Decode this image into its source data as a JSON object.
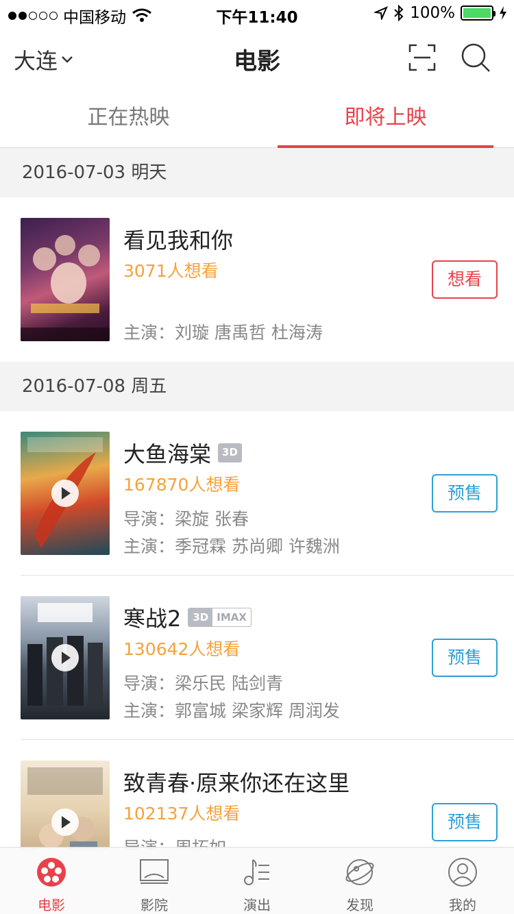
{
  "status_bar": {
    "carrier": "中国移动",
    "time": "下午11:40",
    "battery": "100%"
  },
  "nav": {
    "city": "大连",
    "title": "电影"
  },
  "tabs": [
    {
      "label": "正在热映",
      "active": false
    },
    {
      "label": "即将上映",
      "active": true
    }
  ],
  "sections": [
    {
      "date": "2016-07-03 明天",
      "movies": [
        {
          "title": "看见我和你",
          "want": "3071人想看",
          "cast": "主演：刘璇 唐禹哲 杜海涛",
          "button": "想看"
        }
      ]
    },
    {
      "date": "2016-07-08 周五",
      "movies": [
        {
          "title": "大鱼海棠",
          "badge": "3D",
          "want": "167870人想看",
          "director": "导演：梁旋 张春",
          "cast": "主演：季冠霖 苏尚卿 许魏洲",
          "button": "预售"
        },
        {
          "title": "寒战2",
          "badge": "3D",
          "badge2": "IMAX",
          "want": "130642人想看",
          "director": "导演：梁乐民 陆剑青",
          "cast": "主演：郭富城 梁家辉 周润发",
          "button": "预售"
        },
        {
          "title": "致青春·原来你还在这里",
          "want": "102137人想看",
          "director": "导演：周拓如",
          "button": "预售"
        }
      ]
    }
  ],
  "tabbar": [
    {
      "label": "电影",
      "icon": "film-reel-icon",
      "active": true
    },
    {
      "label": "影院",
      "icon": "cinema-screen-icon",
      "active": false
    },
    {
      "label": "演出",
      "icon": "music-note-icon",
      "active": false
    },
    {
      "label": "发现",
      "icon": "planet-icon",
      "active": false
    },
    {
      "label": "我的",
      "icon": "user-icon",
      "active": false
    }
  ],
  "colors": {
    "accent": "#e8414b",
    "presale": "#2d9fd8",
    "want_count": "#f5a23b"
  }
}
